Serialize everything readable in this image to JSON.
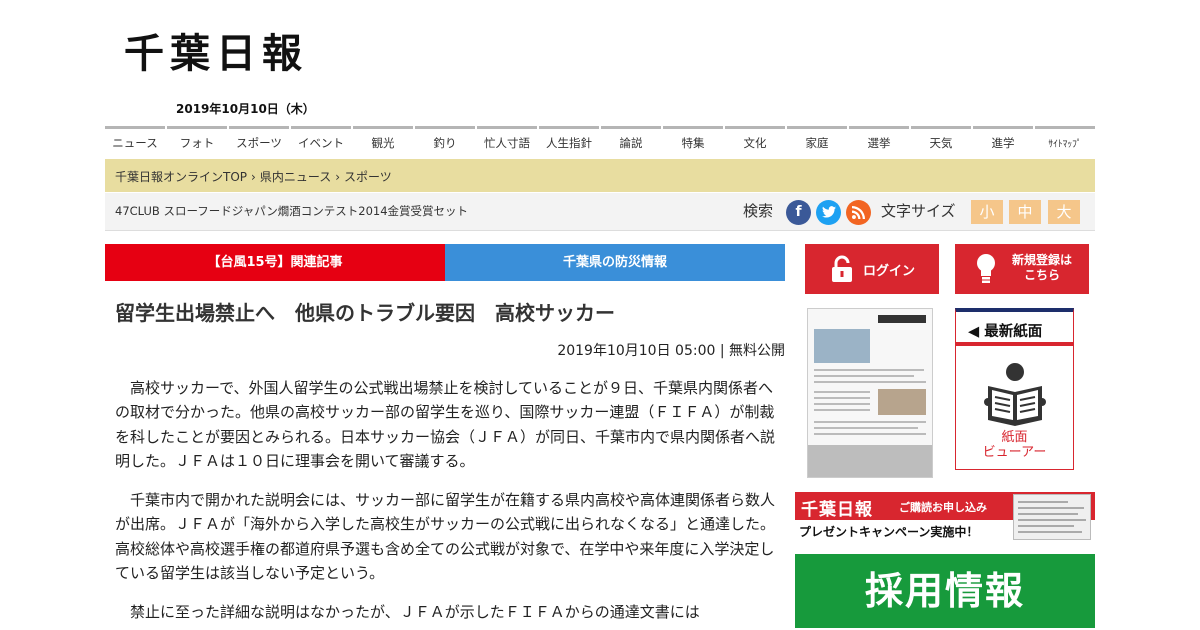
{
  "header": {
    "logo": "千葉日報",
    "date": "2019年10月10日（木）"
  },
  "nav": {
    "items": [
      "ニュース",
      "フォト",
      "スポーツ",
      "イベント",
      "観光",
      "釣り",
      "忙人寸語",
      "人生指針",
      "論説",
      "特集",
      "文化",
      "家庭",
      "選挙",
      "天気",
      "進学",
      "ｻｲﾄﾏｯﾌﾟ"
    ]
  },
  "breadcrumb": {
    "items": [
      "千葉日報オンラインTOP",
      "›",
      "県内ニュース",
      "›",
      "スポーツ"
    ]
  },
  "infobar": {
    "promo": "47CLUB スローフードジャパン燗酒コンテスト2014金賞受賞セット",
    "search_label": "検索",
    "social": {
      "facebook": "f",
      "twitter": "t",
      "rss": "◉"
    },
    "fontsize_label": "文字サイズ",
    "fontsize_small": "小",
    "fontsize_medium": "中",
    "fontsize_large": "大"
  },
  "banners": {
    "typhoon": "【台風15号】関連記事",
    "disaster": "千葉県の防災情報"
  },
  "article": {
    "headline": "留学生出場禁止へ　他県のトラブル要因　高校サッカー",
    "meta": "2019年10月10日 05:00 | 無料公開",
    "paragraphs": [
      "高校サッカーで、外国人留学生の公式戦出場禁止を検討していることが９日、千葉県内関係者への取材で分かった。他県の高校サッカー部の留学生を巡り、国際サッカー連盟（ＦＩＦＡ）が制裁を科したことが要因とみられる。日本サッカー協会（ＪＦＡ）が同日、千葉市内で県内関係者へ説明した。ＪＦＡは１０日に理事会を開いて審議する。",
      "千葉市内で開かれた説明会には、サッカー部に留学生が在籍する県内高校や高体連関係者ら数人が出席。ＪＦＡが「海外から入学した高校生がサッカーの公式戦に出られなくなる」と通達した。高校総体や高校選手権の都道府県予選も含め全ての公式戦が対象で、在学中や来年度に入学決定している留学生は該当しない予定という。",
      "禁止に至った詳細な説明はなかったが、ＪＦＡが示したＦＩＦＡからの通達文書には"
    ]
  },
  "sidebar": {
    "login_label": "ログイン",
    "register_label": "新規登録は\nこちら",
    "latest_title": "◀ 最新紙面",
    "viewer_label_1": "紙面",
    "viewer_label_2": "ビューアー",
    "ad_logo": "千葉日報",
    "ad_apply": "ご購読お申し込み",
    "ad_campaign": "プレゼントキャンペーン実施中！",
    "recruit": "採用情報"
  },
  "colors": {
    "red": "#e60012",
    "blue": "#3a8fd9",
    "breadcrumb_bg": "#e8dda0",
    "fontsize_btn": "#f5c68a",
    "recruit_green": "#179a3c",
    "sidebar_red": "#d8262f"
  },
  "icons": [
    "lock-icon",
    "lightbulb-icon",
    "newspaper-reader-icon",
    "facebook-icon",
    "twitter-icon",
    "rss-icon"
  ]
}
